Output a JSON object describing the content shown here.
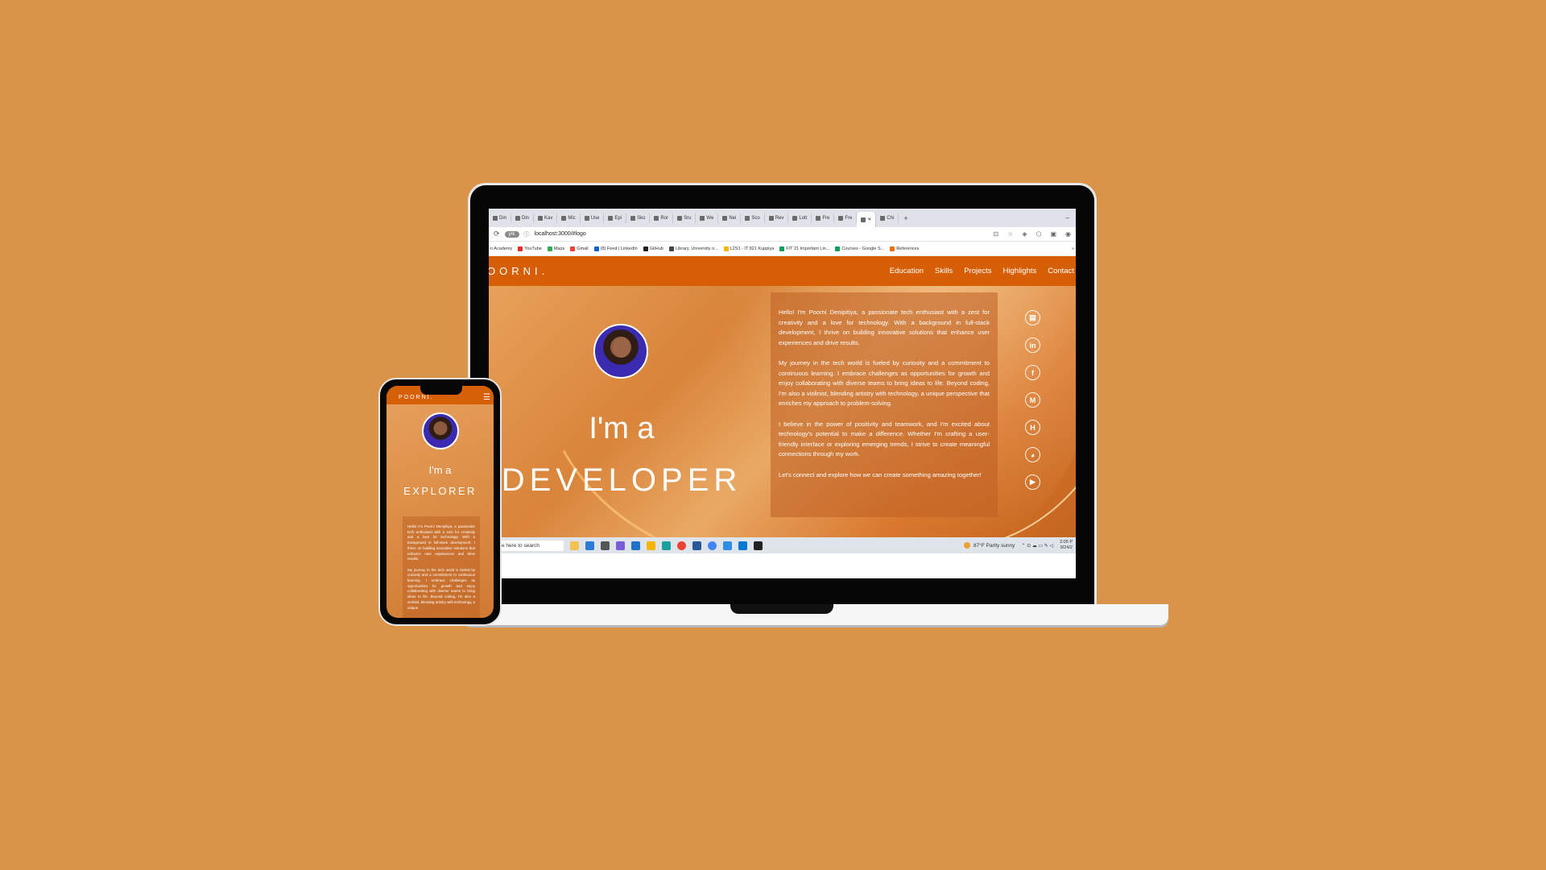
{
  "browser": {
    "tabs": [
      "Din",
      "Din",
      "Kav",
      "Mic",
      "Use",
      "Epi",
      "Sko",
      "Ror",
      "Sru",
      "We",
      "Nei",
      "Sco",
      "Rev",
      "Lott",
      "Fre",
      "Fre",
      "",
      "Chi"
    ],
    "active_tab_index": 16,
    "new_tab": "+",
    "window_controls": "–",
    "extension_badge": "yrk",
    "url": "localhost:3000/#logo",
    "bookmarks": [
      "n Academy",
      "YouTube",
      "Maps",
      "Gmail",
      "(8) Feed | LinkedIn",
      "GitHub",
      "Library, University o...",
      "L2S1 - IT 821 Kuppiya",
      "FIT 21 Important Lin...",
      "Courses - Google S...",
      "References"
    ],
    "bookmarks_more": "»"
  },
  "site": {
    "logo": "OORNI.",
    "nav": [
      "Education",
      "Skills",
      "Projects",
      "Highlights",
      "Contact"
    ],
    "greeting": "I'm a",
    "role": "DEVELOPER",
    "about": [
      "Hello! I'm Poorni Denipitiya, a passionate tech enthusiast with a zest for creativity and a love for technology. With a background in full-stack development, I thrive on building innovative solutions that enhance user experiences and drive results.",
      "My journey in the tech world is fueled by curiosity and a commitment to continuous learning. I embrace challenges as opportunities for growth and enjoy collaborating with diverse teams to bring ideas to life. Beyond coding, I'm also a violinist, blending artistry with technology, a unique perspective that enriches my approach to problem-solving.",
      "I believe in the power of positivity and teamwork, and I'm excited about technology's potential to make a difference. Whether I'm crafting a user-friendly interface or exploring emerging trends, I strive to create meaningful connections through my work.",
      "Let's connect and explore how we can create something amazing together!"
    ],
    "social_icons": [
      "resume-icon",
      "linkedin-icon",
      "facebook-icon",
      "medium-icon",
      "hashnode-icon",
      "github-icon",
      "youtube-icon"
    ],
    "accent_color": "#d65f05"
  },
  "taskbar": {
    "search_placeholder": "e here to search",
    "weather": "87°F  Partly sunny",
    "time": "2:05 P",
    "date": "9/24/2"
  },
  "phone": {
    "logo": "POORNI.",
    "greeting": "I'm a",
    "role": "EXPLORER",
    "about": [
      "Hello! I'm Poorni Denipitiya, a passionate tech enthusiast with a zest for creativity and a love for technology. With a background in full-stack development, I thrive on building innovative solutions that enhance user experiences and drive results.",
      "My journey in the tech world is fueled by curiosity and a commitment to continuous learning. I embrace challenges as opportunities for growth and enjoy collaborating with diverse teams to bring ideas to life. Beyond coding, I'm also a violinist, blending artistry with technology, a unique"
    ]
  },
  "colors": {
    "background": "#da9449",
    "navbar": "#d65f05"
  }
}
